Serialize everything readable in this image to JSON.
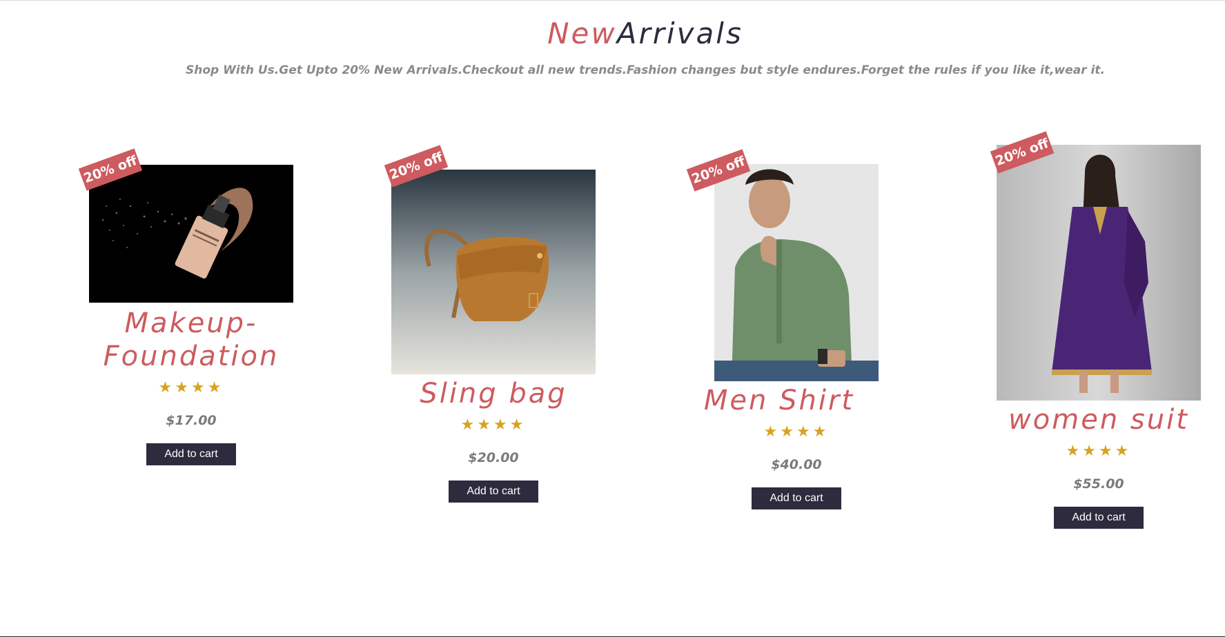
{
  "heading": {
    "accent": "New",
    "rest": "Arrivals"
  },
  "subtitle": "Shop With Us.Get Upto 20% New Arrivals.Checkout all new trends.Fashion changes but style endures.Forget the rules if you like it,wear it.",
  "colors": {
    "accent": "#cd5b5f",
    "dark": "#2d2b3d",
    "star": "#d9a21f",
    "muted": "#7a7a7a"
  },
  "products": [
    {
      "badge": "20% off",
      "name_line1": "Makeup-",
      "name_line2": "Foundation",
      "rating": 4,
      "stars": "★★★★",
      "price": "$17.00",
      "button": "Add to cart",
      "image": "foundation-bottle-image"
    },
    {
      "badge": "20% off",
      "name": "Sling bag",
      "rating": 4,
      "stars": "★★★★",
      "price": "$20.00",
      "button": "Add to cart",
      "image": "leather-sling-bag-image"
    },
    {
      "badge": "20% off",
      "name": "Men Shirt",
      "rating": 4,
      "stars": "★★★★",
      "price": "$40.00",
      "button": "Add to cart",
      "image": "green-shirt-model-image"
    },
    {
      "badge": "20% off",
      "name": "women suit",
      "rating": 4,
      "stars": "★★★★",
      "price": "$55.00",
      "button": "Add to cart",
      "image": "purple-suit-model-image"
    }
  ]
}
